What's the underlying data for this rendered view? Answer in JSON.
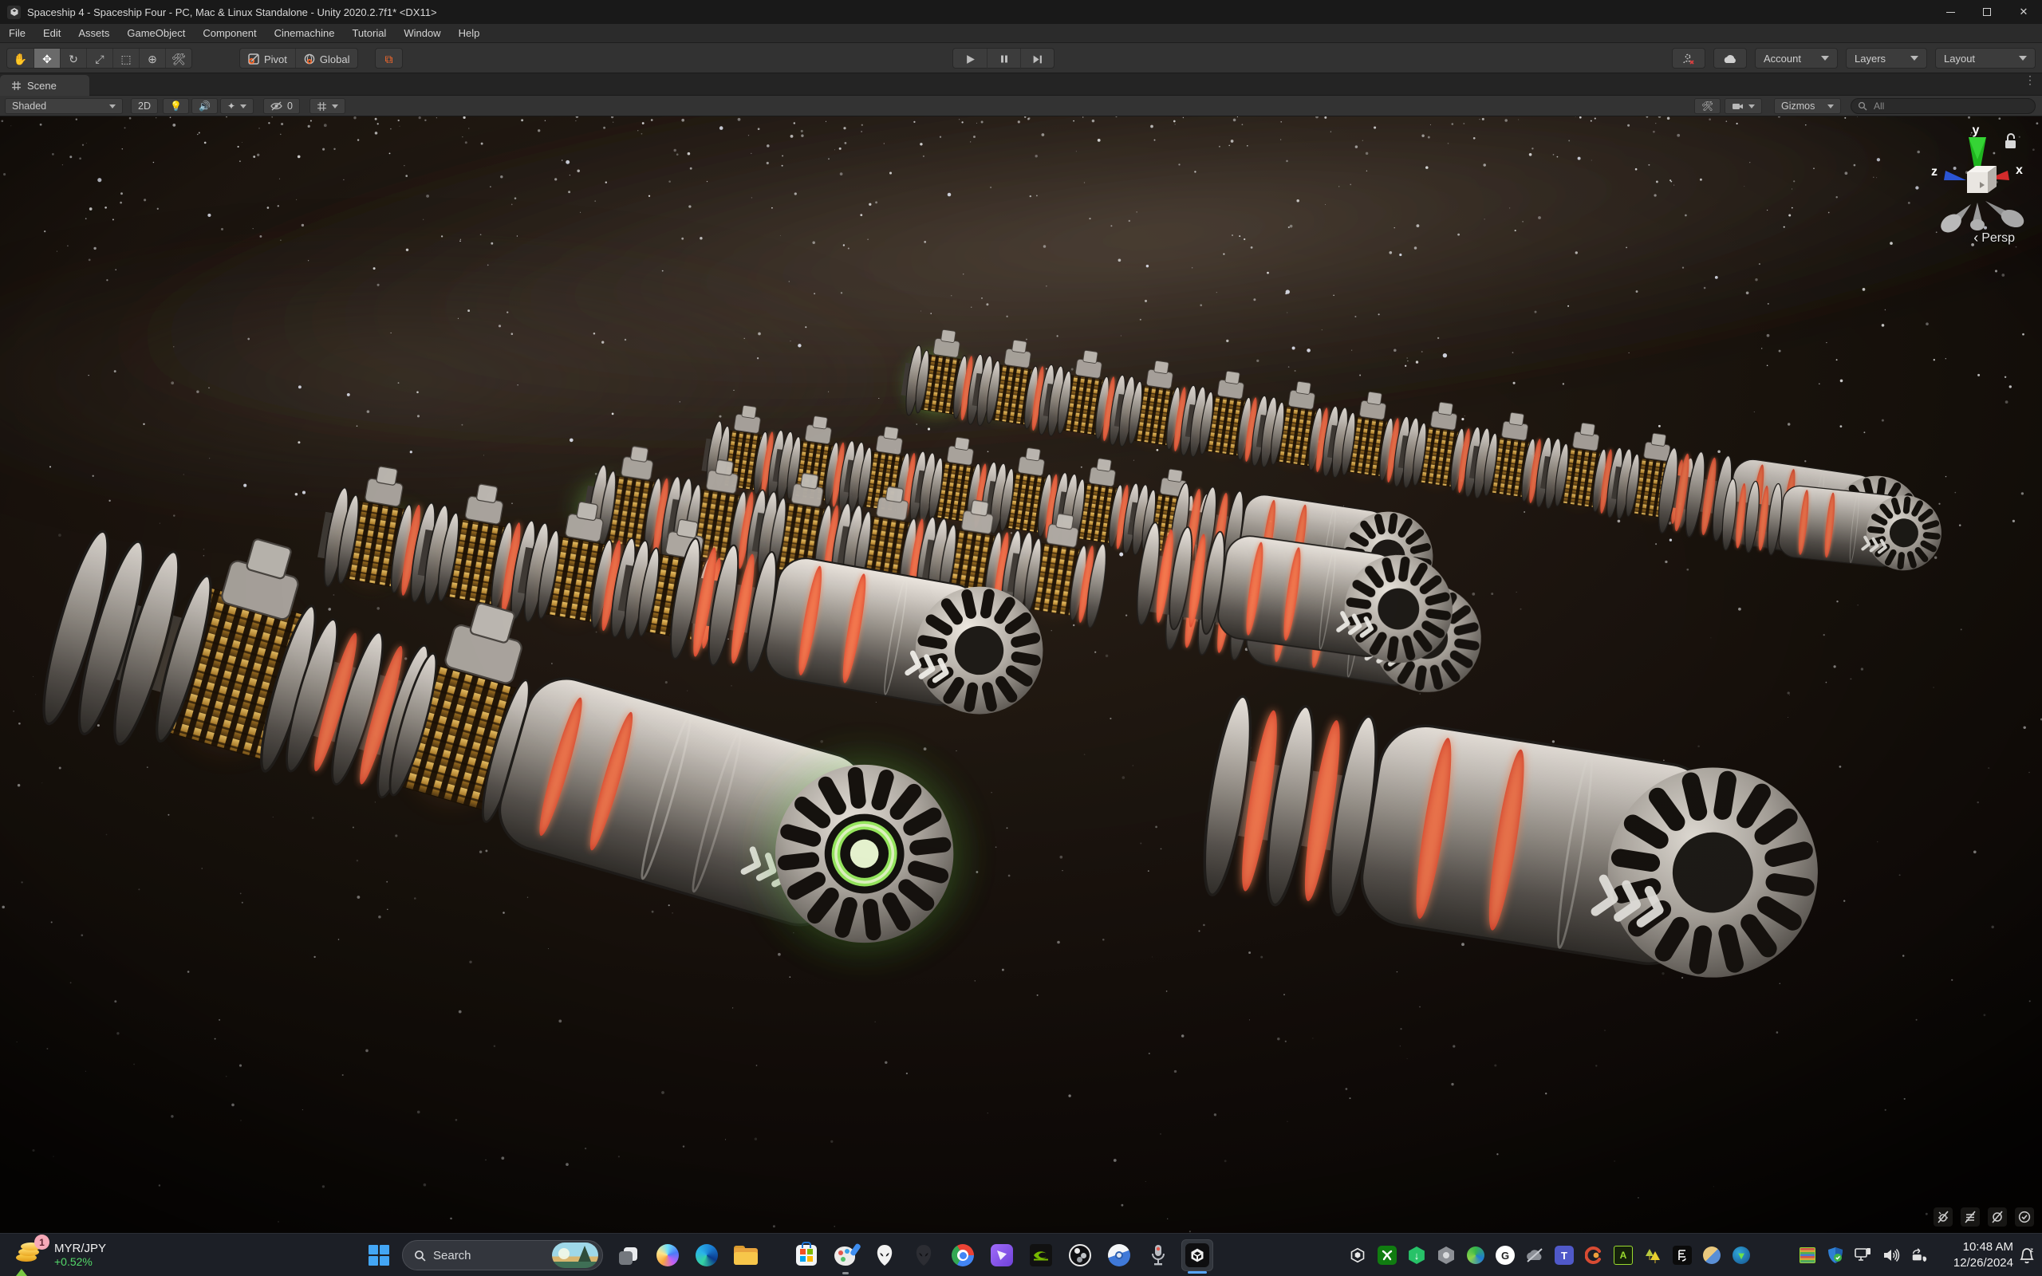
{
  "window": {
    "title": "Spaceship 4 - Spaceship Four - PC, Mac & Linux Standalone - Unity 2020.2.7f1* <DX11>"
  },
  "menu": {
    "items": [
      "File",
      "Edit",
      "Assets",
      "GameObject",
      "Component",
      "Cinemachine",
      "Tutorial",
      "Window",
      "Help"
    ]
  },
  "toolbar": {
    "pivot": "Pivot",
    "global": "Global",
    "account": "Account",
    "layers": "Layers",
    "layout": "Layout"
  },
  "tabs": {
    "scene": "Scene"
  },
  "scene_toolbar": {
    "shading": "Shaded",
    "two_d": "2D",
    "hidden_count": "0",
    "gizmos": "Gizmos",
    "search_placeholder": "All"
  },
  "scene_view": {
    "axis": {
      "x": "x",
      "y": "y",
      "z": "z"
    },
    "projection": "Persp"
  },
  "taskbar": {
    "widget": {
      "pair": "MYR/JPY",
      "change": "+0.52%",
      "badge": "1"
    },
    "search": "Search",
    "clock": {
      "time": "10:48 AM",
      "date": "12/26/2024"
    }
  },
  "icons": {
    "toolbar_tools": [
      "hand-tool",
      "move-tool",
      "rotate-tool",
      "scale-tool",
      "rect-tool",
      "transform-tool",
      "custom-tool"
    ],
    "taskbar_apps": [
      "start",
      "search",
      "task-view",
      "copilot",
      "edge",
      "file-explorer",
      "microsoft-store",
      "paint",
      "alienware",
      "alienware-command-center",
      "chrome",
      "clipchamp",
      "nvidia",
      "obs-studio",
      "blue-white-app",
      "voice-recorder",
      "unity"
    ],
    "tray": [
      "unity-tray",
      "xbox",
      "download-manager",
      "badge",
      "idm",
      "g-app",
      "onedrive-off",
      "teams",
      "ccleaner",
      "green-sheet",
      "tree-warning",
      "epic-games",
      "dual-tone-app",
      "globe-arrow",
      "stripes-monitor",
      "defender",
      "network",
      "volume",
      "cast-sync",
      "notification-bell"
    ]
  },
  "colors": {
    "selected_tool_bg": "#6a6a6a",
    "accent_orange": "#ff6b2b",
    "widget_green": "#53d769",
    "taskbar_accent": "#58a6ff",
    "glow_green": "#9df263",
    "glow_red": "#e8473a",
    "gold": "#c08a2e"
  }
}
